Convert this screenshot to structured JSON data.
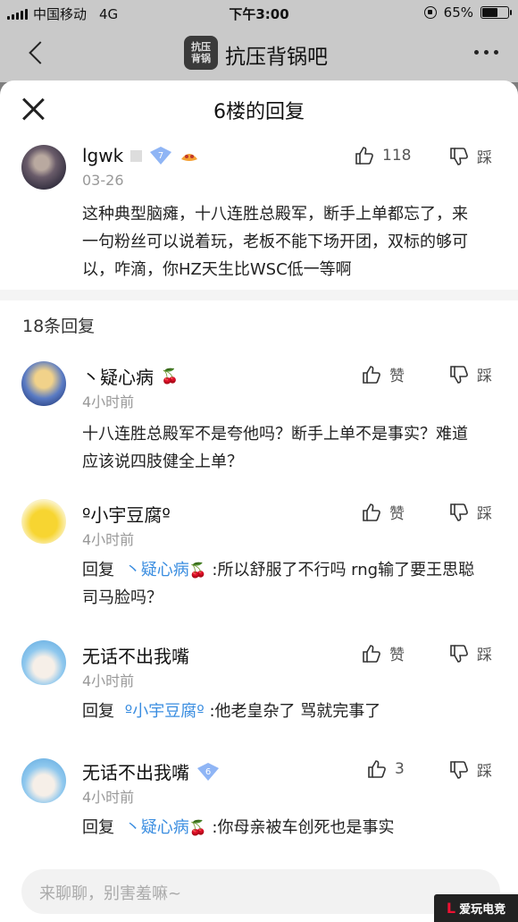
{
  "statusbar": {
    "carrier": "中国移动",
    "network": "4G",
    "time": "下午3:00",
    "battery": "65%",
    "battery_level": 0.65
  },
  "navbar": {
    "back_icon": "chevron-left-icon",
    "forum_title": "抗压背锅吧",
    "more_icon": "more-icon"
  },
  "sheet": {
    "title": "6楼的回复",
    "close_icon": "close-icon"
  },
  "op": {
    "username": "lgwk",
    "date": "03-26",
    "level": "7",
    "text": "这种典型脑瘫，十八连胜总殿军，断手上单都忘了，来一句粉丝可以说着玩，老板不能下场开团，双标的够可以，咋滴，你HZ天生比WSC低一等啊",
    "like_count": "118",
    "dislike_label": "踩"
  },
  "replies_count": "18条回复",
  "replies": [
    {
      "username": "丶疑心病",
      "time": "4小时前",
      "reply_prefix": "",
      "mention": "",
      "text": "十八连胜总殿军不是夸他吗？断手上单不是事实？难道应该说四肢健全上单？",
      "like_label": "赞",
      "dislike_label": "踩"
    },
    {
      "username": "º小宇豆腐º",
      "time": "4小时前",
      "reply_prefix": "回复",
      "mention": "丶疑心病",
      "text": ":所以舒服了不行吗 rng输了要王思聪司马脸吗？",
      "like_label": "赞",
      "dislike_label": "踩"
    },
    {
      "username": "无话不出我嘴",
      "time": "4小时前",
      "reply_prefix": "回复",
      "mention": "º小宇豆腐º",
      "text": ":他老皇杂了 骂就完事了",
      "like_label": "赞",
      "dislike_label": "踩"
    },
    {
      "username": "无话不出我嘴",
      "time": "4小时前",
      "level": "6",
      "reply_prefix": "回复",
      "mention": "丶疑心病",
      "text": ":你母亲被车创死也是事实",
      "like_count": "3",
      "dislike_label": "踩"
    }
  ],
  "composer": {
    "placeholder": "来聊聊，别害羞嘛~"
  },
  "colors": {
    "mention": "#3a8de0",
    "level_badge": "#8fb5f5",
    "cherry": "#d12"
  }
}
